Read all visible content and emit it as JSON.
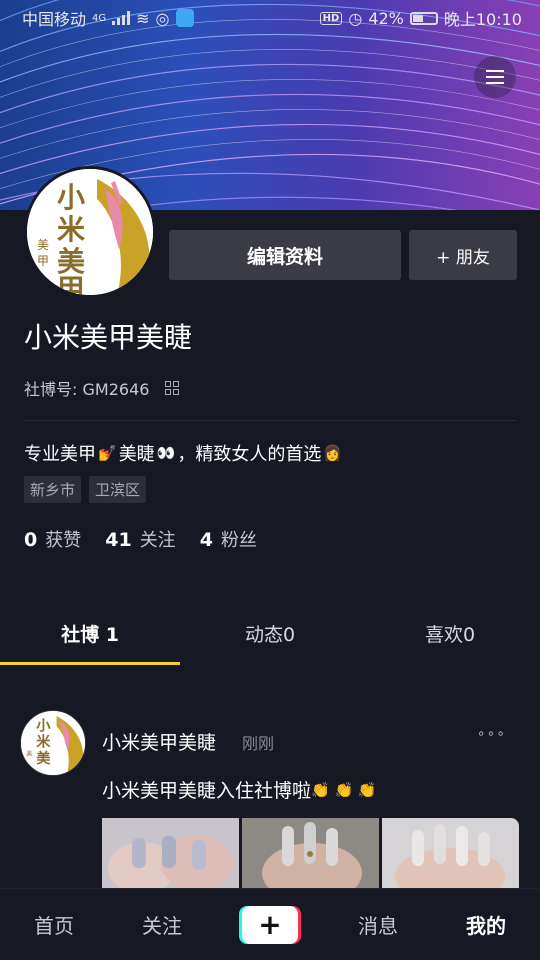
{
  "status_bar": {
    "carrier": "中国移动",
    "network": "4G",
    "battery": "42%",
    "time": "晚上10:10"
  },
  "profile": {
    "name": "小米美甲美睫",
    "account_label": "社博号:",
    "account_id": "GM2646",
    "edit_button": "编辑资料",
    "friend_button": "+ 朋友",
    "bio_part1": "专业美甲",
    "bio_part2": "美睫",
    "bio_part3": "，精致女人的首选",
    "tags": [
      "新乡市",
      "卫滨区"
    ],
    "stats": [
      {
        "num": "0",
        "label": "获赞"
      },
      {
        "num": "41",
        "label": "关注"
      },
      {
        "num": "4",
        "label": "粉丝"
      }
    ]
  },
  "logo_text": {
    "big": "小米美甲",
    "small": "美甲"
  },
  "tabs": [
    {
      "label": "社博 1",
      "active": true
    },
    {
      "label": "动态0",
      "active": false
    },
    {
      "label": "喜欢0",
      "active": false
    }
  ],
  "post": {
    "author": "小米美甲美睫",
    "time": "刚刚",
    "text": "小米美甲美睫入住社博啦",
    "more": "∘∘∘"
  },
  "bottom_nav": {
    "home": "首页",
    "follow": "关注",
    "plus": "+",
    "messages": "消息",
    "me": "我的"
  },
  "colors": {
    "background": "#161823",
    "tab_indicator": "#facf1f",
    "button_bg": "#3a3b44",
    "logo_gold": "#c9a227",
    "logo_pink": "#e98aa8"
  }
}
